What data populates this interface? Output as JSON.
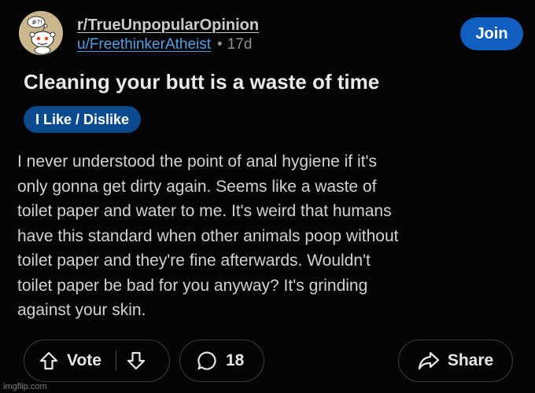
{
  "header": {
    "subreddit": "r/TrueUnpopularOpinion",
    "username": "u/FreethinkerAtheist",
    "separator": "•",
    "age": "17d",
    "join_label": "Join",
    "avatar_icon": "subreddit-avatar-icon"
  },
  "post": {
    "title": "Cleaning your butt is a waste of time",
    "flair": "I Like / Dislike",
    "body": "I never understood the point of anal hygiene if it's\nonly gonna get dirty again. Seems like a waste of\ntoilet paper and water to me. It's weird that humans\nhave this standard when other animals poop without\ntoilet paper and they're fine afterwards. Wouldn't\ntoilet paper be bad for you anyway? It's grinding\nagainst your skin."
  },
  "actions": {
    "vote_label": "Vote",
    "upvote_icon": "arrow-up-icon",
    "downvote_icon": "arrow-down-icon",
    "comment_icon": "speech-bubble-icon",
    "comment_count": "18",
    "share_icon": "share-arrow-icon",
    "share_label": "Share"
  },
  "watermark": "imgflip.com",
  "colors": {
    "background": "#050505",
    "join_button": "#0f5ec0",
    "flair_bg": "#0b4a8e",
    "username": "#4f9fe6",
    "text": "#cfd3d6"
  }
}
